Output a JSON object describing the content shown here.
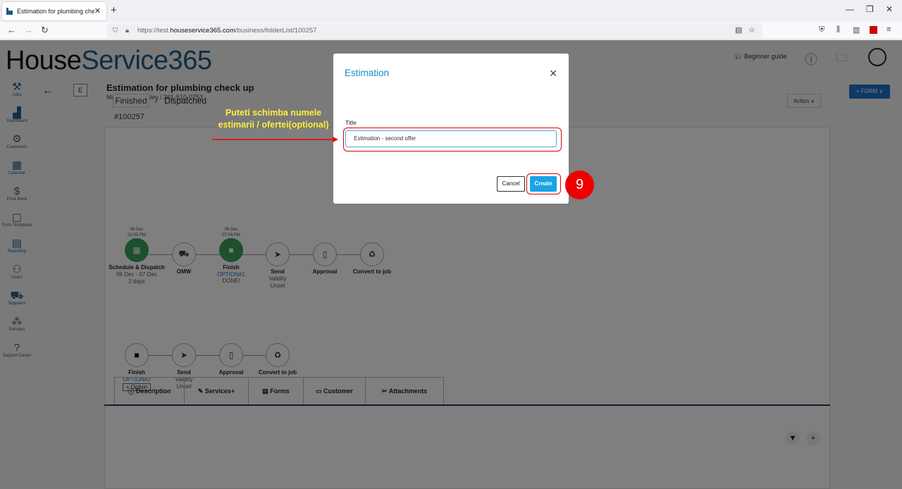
{
  "browser": {
    "tab_title": "Estimation for plumbing check up",
    "url_prefix": "https://test.",
    "url_domain": "houseservice365.com",
    "url_path": "/business/folderList/100257"
  },
  "app": {
    "logo_part1": "House",
    "logo_part2": "Service365",
    "beginner_guide": "Beginner guide",
    "form_button": "+ FORM ∨"
  },
  "sidebar": {
    "items": [
      {
        "label": "Jobs",
        "icon": "jobs-icon"
      },
      {
        "label": "Dashboard",
        "icon": "dashboard-icon"
      },
      {
        "label": "Customers",
        "icon": "customers-icon"
      },
      {
        "label": "Calendar",
        "icon": "calendar-icon"
      },
      {
        "label": "Price Book",
        "icon": "price-book-icon"
      },
      {
        "label": "Form Templates",
        "icon": "form-templates-icon"
      },
      {
        "label": "Reporting",
        "icon": "reporting-icon"
      },
      {
        "label": "Users",
        "icon": "users-icon"
      },
      {
        "label": "Suppliers",
        "icon": "suppliers-icon"
      },
      {
        "label": "Partners",
        "icon": "partners-icon"
      },
      {
        "label": "Support Center",
        "icon": "support-center-icon"
      }
    ]
  },
  "job": {
    "badge": "E",
    "title": "Estimation for plumbing check up",
    "subtitle": "Marjorie M. Lesley / 361-510-0753",
    "status_finished": "Finished",
    "status_dispatched": "Dispatched",
    "number": "#100257",
    "action": "Action ∨"
  },
  "workflow1": [
    {
      "date1": "06 Dec",
      "date2": "02:03 PM",
      "label": "Schedule & Dispatch",
      "sub1": "06 Dec - 07 Dec",
      "sub2": "2 days"
    },
    {
      "label": "OMW"
    },
    {
      "date1": "06 Dec",
      "date2": "07:04 PM",
      "label": "Finish",
      "option": "OPTION#1",
      "sub1": "DONE!"
    },
    {
      "label": "Send",
      "sub1": "Validity",
      "sub2": "Unset"
    },
    {
      "label": "Approval"
    },
    {
      "label": "Convert to job"
    }
  ],
  "workflow2": [
    {
      "label": "Finish",
      "option": "OPTION#2",
      "button": "+ Option"
    },
    {
      "label": "Send",
      "sub1": "Validity",
      "sub2": "Unset"
    },
    {
      "label": "Approval"
    },
    {
      "label": "Convert to job"
    }
  ],
  "tabs": [
    "Description",
    "Services+",
    "Forms",
    "Customer",
    "Attachments"
  ],
  "modal": {
    "title": "Estimation",
    "field_label": "Title",
    "field_value": "Estimation - second offer",
    "cancel": "Cancel",
    "create": "Create"
  },
  "annotation": {
    "text": "Puteti schimba numele estimarii / ofertei(optional)",
    "step": "9",
    "color_text": "#ffef3a",
    "color_marker": "#e00000"
  }
}
